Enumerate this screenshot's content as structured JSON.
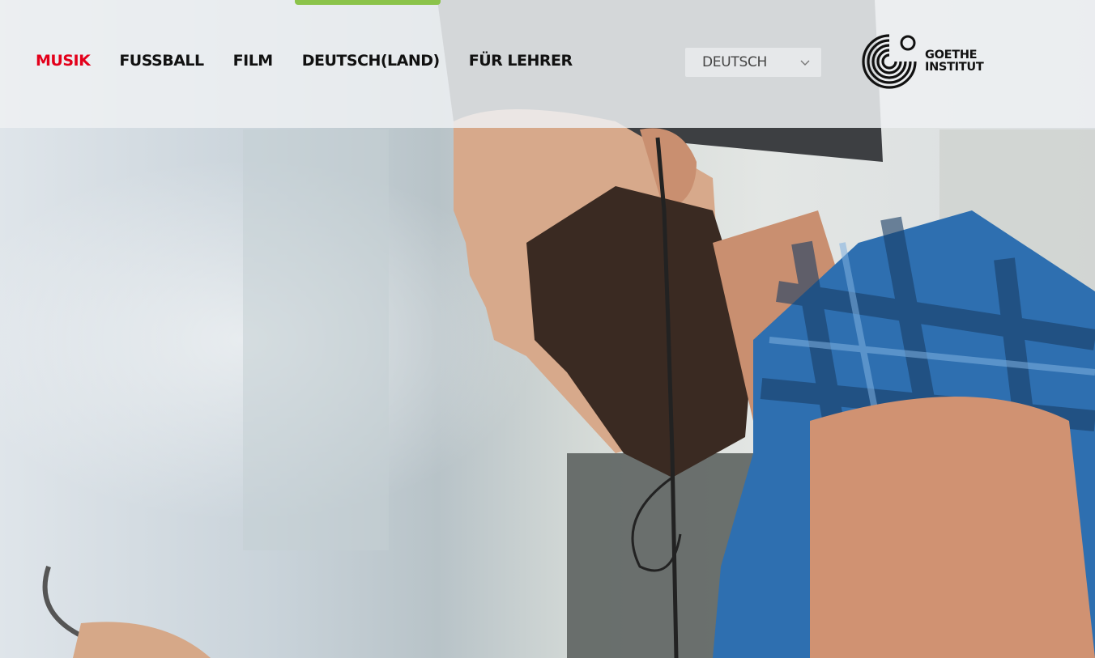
{
  "nav": {
    "items": [
      {
        "label": "MUSIK",
        "active": true
      },
      {
        "label": "FUSSBALL",
        "active": false
      },
      {
        "label": "FILM",
        "active": false
      },
      {
        "label": "DEUTSCH(LAND)",
        "active": false
      },
      {
        "label": "FÜR LEHRER",
        "active": false
      }
    ]
  },
  "language": {
    "selected": "DEUTSCH",
    "icon": "chevron-down-icon"
  },
  "logo": {
    "line1": "GOETHE",
    "line2": "INSTITUT",
    "icon": "goethe-logo-icon"
  },
  "hero": {
    "image": "hero-photo"
  },
  "colors": {
    "accent": "#e3001b",
    "nav_text": "#111111",
    "top_tab": "#8bc34a"
  }
}
